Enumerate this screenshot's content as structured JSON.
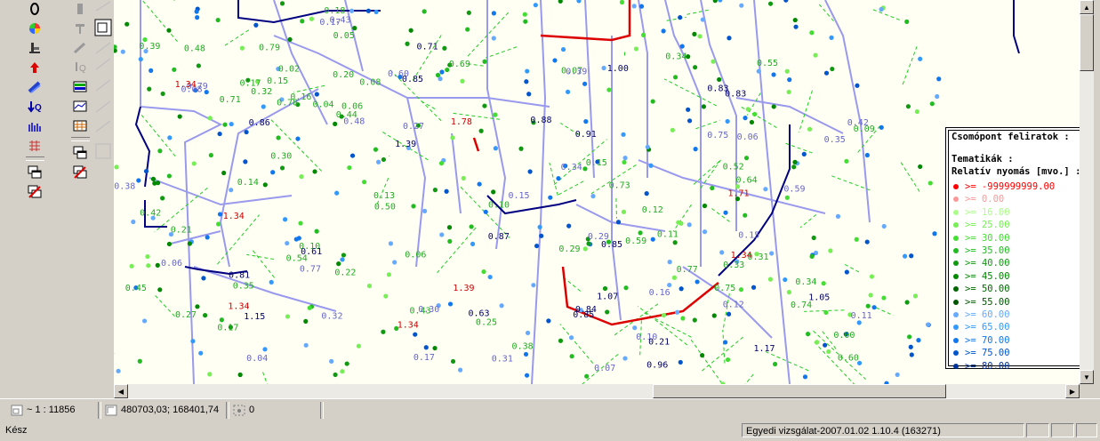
{
  "toolbar": {
    "left_icons": [
      "zero-icon",
      "pie-chart-icon",
      "fire-hydrant-icon",
      "red-arrow-up-icon",
      "pipe-icon",
      "downarrow-q-icon",
      "histogram-icon",
      "grid-icon",
      "windows-stack-icon",
      "cancel-windows-icon"
    ],
    "right_icons": [
      "tool-a-icon",
      "tool-b-icon",
      "tool-c-icon",
      "q-tool-icon",
      "panel-icon",
      "cross-section-icon",
      "layers-grid-icon",
      "windows-stack-icon",
      "cancel-windows-icon"
    ]
  },
  "map": {
    "labels_pipe": [
      "0.83",
      "0.84",
      "0.85",
      "0.96",
      "1.39",
      "1.05",
      "0.86",
      "0.63",
      "0.85",
      "0.85",
      "0.91",
      "1.00",
      "0.61",
      "0.81",
      "1.07",
      "0.83",
      "0.88",
      "1.15",
      "0.21",
      "0.87",
      "1.17",
      "0.71"
    ],
    "labels_red": [
      "1.34",
      "1.78",
      "1.34",
      "1.34",
      "1.34",
      "1.34",
      "1.39",
      "1.71"
    ],
    "labels_flow": [
      "0.16",
      "0.06",
      "0.11",
      "0.04",
      "0.10",
      "0.48",
      "0.42",
      "0.07",
      "0.15",
      "0.79",
      "0.35",
      "0.38",
      "0.77",
      "0.17",
      "0.15",
      "0.43",
      "0.30",
      "0.12",
      "0.27",
      "0.06",
      "0.08",
      "0.29",
      "0.75",
      "0.39",
      "0.32",
      "0.34",
      "0.17",
      "0.60",
      "0.31",
      "0.59",
      "0.64",
      "0.55",
      "0.44",
      "0.13",
      "0.05",
      "0.20",
      "0.34",
      "0.25",
      "0.02",
      "0.00",
      "0.09",
      "0.14",
      "0.71",
      "0.73",
      "0.78",
      "0.50",
      "0.52",
      "0.45",
      "0.21",
      "0.18",
      "0.33",
      "0.54",
      "0.69",
      "0.74",
      "0.22",
      "0.10"
    ]
  },
  "legend": {
    "title": "Csomópont feliratok :",
    "subtitle": "Tematikák :",
    "heading": "Relatív nyomás [mvo.] :",
    "items": [
      {
        "label": ">= -999999999.00",
        "color": "#ff0000"
      },
      {
        "label": ">= 0.00",
        "color": "#ff9999"
      },
      {
        "label": ">= 16.00",
        "color": "#aaff88"
      },
      {
        "label": ">= 25.00",
        "color": "#77ee55"
      },
      {
        "label": ">= 30.00",
        "color": "#44dd33"
      },
      {
        "label": ">= 35.00",
        "color": "#22bb22"
      },
      {
        "label": ">= 40.00",
        "color": "#119911"
      },
      {
        "label": ">= 45.00",
        "color": "#008800"
      },
      {
        "label": ">= 50.00",
        "color": "#006600"
      },
      {
        "label": ">= 55.00",
        "color": "#005500"
      },
      {
        "label": ">= 60.00",
        "color": "#66aaff"
      },
      {
        "label": ">= 65.00",
        "color": "#3399ff"
      },
      {
        "label": ">= 70.00",
        "color": "#1177ee"
      },
      {
        "label": ">= 75.00",
        "color": "#0055cc"
      },
      {
        "label": ">= 80.00",
        "color": "#003399"
      }
    ],
    "overflow_label": "0.00"
  },
  "infobar": {
    "scale": "~ 1 : 11856",
    "coords": "480703,03; 168401,74",
    "count": "0"
  },
  "status": {
    "text": "Kész",
    "project": "Egyedi vizsgálat-2007.01.02 1.10.4 (163271)"
  },
  "colors": {
    "pipe": "#9999ee",
    "pipe_dark": "#000080",
    "flow": "#22cc22",
    "red": "#dd0000",
    "map_bg": "#fffff4"
  }
}
